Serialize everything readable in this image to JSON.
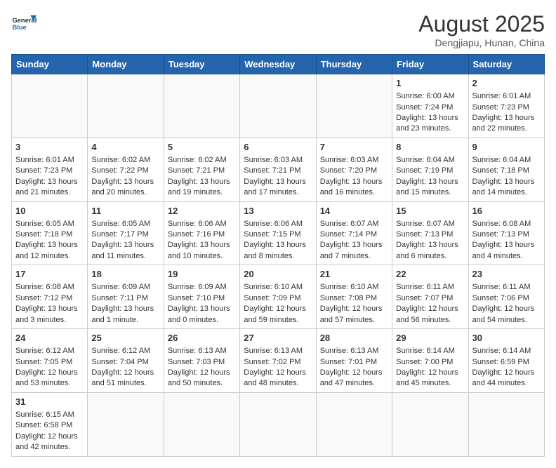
{
  "logo": {
    "general": "General",
    "blue": "Blue"
  },
  "title": "August 2025",
  "subtitle": "Dengjiapu, Hunan, China",
  "weekdays": [
    "Sunday",
    "Monday",
    "Tuesday",
    "Wednesday",
    "Thursday",
    "Friday",
    "Saturday"
  ],
  "weeks": [
    [
      {
        "day": "",
        "info": ""
      },
      {
        "day": "",
        "info": ""
      },
      {
        "day": "",
        "info": ""
      },
      {
        "day": "",
        "info": ""
      },
      {
        "day": "",
        "info": ""
      },
      {
        "day": "1",
        "info": "Sunrise: 6:00 AM\nSunset: 7:24 PM\nDaylight: 13 hours and 23 minutes."
      },
      {
        "day": "2",
        "info": "Sunrise: 6:01 AM\nSunset: 7:23 PM\nDaylight: 13 hours and 22 minutes."
      }
    ],
    [
      {
        "day": "3",
        "info": "Sunrise: 6:01 AM\nSunset: 7:23 PM\nDaylight: 13 hours and 21 minutes."
      },
      {
        "day": "4",
        "info": "Sunrise: 6:02 AM\nSunset: 7:22 PM\nDaylight: 13 hours and 20 minutes."
      },
      {
        "day": "5",
        "info": "Sunrise: 6:02 AM\nSunset: 7:21 PM\nDaylight: 13 hours and 19 minutes."
      },
      {
        "day": "6",
        "info": "Sunrise: 6:03 AM\nSunset: 7:21 PM\nDaylight: 13 hours and 17 minutes."
      },
      {
        "day": "7",
        "info": "Sunrise: 6:03 AM\nSunset: 7:20 PM\nDaylight: 13 hours and 16 minutes."
      },
      {
        "day": "8",
        "info": "Sunrise: 6:04 AM\nSunset: 7:19 PM\nDaylight: 13 hours and 15 minutes."
      },
      {
        "day": "9",
        "info": "Sunrise: 6:04 AM\nSunset: 7:18 PM\nDaylight: 13 hours and 14 minutes."
      }
    ],
    [
      {
        "day": "10",
        "info": "Sunrise: 6:05 AM\nSunset: 7:18 PM\nDaylight: 13 hours and 12 minutes."
      },
      {
        "day": "11",
        "info": "Sunrise: 6:05 AM\nSunset: 7:17 PM\nDaylight: 13 hours and 11 minutes."
      },
      {
        "day": "12",
        "info": "Sunrise: 6:06 AM\nSunset: 7:16 PM\nDaylight: 13 hours and 10 minutes."
      },
      {
        "day": "13",
        "info": "Sunrise: 6:06 AM\nSunset: 7:15 PM\nDaylight: 13 hours and 8 minutes."
      },
      {
        "day": "14",
        "info": "Sunrise: 6:07 AM\nSunset: 7:14 PM\nDaylight: 13 hours and 7 minutes."
      },
      {
        "day": "15",
        "info": "Sunrise: 6:07 AM\nSunset: 7:13 PM\nDaylight: 13 hours and 6 minutes."
      },
      {
        "day": "16",
        "info": "Sunrise: 6:08 AM\nSunset: 7:13 PM\nDaylight: 13 hours and 4 minutes."
      }
    ],
    [
      {
        "day": "17",
        "info": "Sunrise: 6:08 AM\nSunset: 7:12 PM\nDaylight: 13 hours and 3 minutes."
      },
      {
        "day": "18",
        "info": "Sunrise: 6:09 AM\nSunset: 7:11 PM\nDaylight: 13 hours and 1 minute."
      },
      {
        "day": "19",
        "info": "Sunrise: 6:09 AM\nSunset: 7:10 PM\nDaylight: 13 hours and 0 minutes."
      },
      {
        "day": "20",
        "info": "Sunrise: 6:10 AM\nSunset: 7:09 PM\nDaylight: 12 hours and 59 minutes."
      },
      {
        "day": "21",
        "info": "Sunrise: 6:10 AM\nSunset: 7:08 PM\nDaylight: 12 hours and 57 minutes."
      },
      {
        "day": "22",
        "info": "Sunrise: 6:11 AM\nSunset: 7:07 PM\nDaylight: 12 hours and 56 minutes."
      },
      {
        "day": "23",
        "info": "Sunrise: 6:11 AM\nSunset: 7:06 PM\nDaylight: 12 hours and 54 minutes."
      }
    ],
    [
      {
        "day": "24",
        "info": "Sunrise: 6:12 AM\nSunset: 7:05 PM\nDaylight: 12 hours and 53 minutes."
      },
      {
        "day": "25",
        "info": "Sunrise: 6:12 AM\nSunset: 7:04 PM\nDaylight: 12 hours and 51 minutes."
      },
      {
        "day": "26",
        "info": "Sunrise: 6:13 AM\nSunset: 7:03 PM\nDaylight: 12 hours and 50 minutes."
      },
      {
        "day": "27",
        "info": "Sunrise: 6:13 AM\nSunset: 7:02 PM\nDaylight: 12 hours and 48 minutes."
      },
      {
        "day": "28",
        "info": "Sunrise: 6:13 AM\nSunset: 7:01 PM\nDaylight: 12 hours and 47 minutes."
      },
      {
        "day": "29",
        "info": "Sunrise: 6:14 AM\nSunset: 7:00 PM\nDaylight: 12 hours and 45 minutes."
      },
      {
        "day": "30",
        "info": "Sunrise: 6:14 AM\nSunset: 6:59 PM\nDaylight: 12 hours and 44 minutes."
      }
    ],
    [
      {
        "day": "31",
        "info": "Sunrise: 6:15 AM\nSunset: 6:58 PM\nDaylight: 12 hours and 42 minutes."
      },
      {
        "day": "",
        "info": ""
      },
      {
        "day": "",
        "info": ""
      },
      {
        "day": "",
        "info": ""
      },
      {
        "day": "",
        "info": ""
      },
      {
        "day": "",
        "info": ""
      },
      {
        "day": "",
        "info": ""
      }
    ]
  ]
}
